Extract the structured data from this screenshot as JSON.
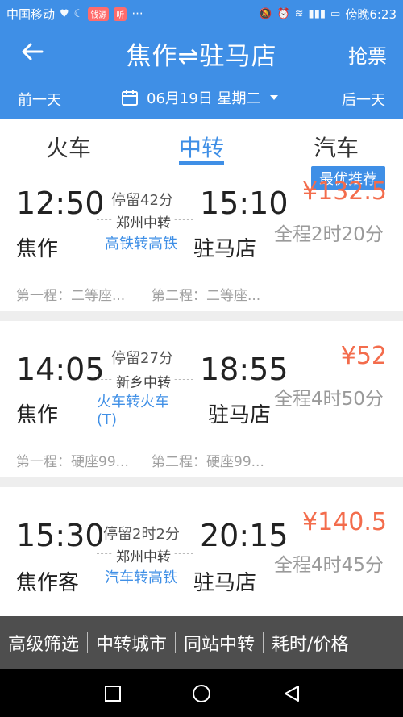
{
  "status_bar": {
    "carrier": "中国移动",
    "app_chip": "钱源",
    "app_icon": "听",
    "more": "···",
    "time": "傍晚6:23"
  },
  "header": {
    "title": "焦作⇌驻马店",
    "action": "抢票",
    "back_icon": "arrow-left-icon"
  },
  "date_bar": {
    "prev": "前一天",
    "date": "06月19日 星期二",
    "next": "后一天"
  },
  "tabs": [
    {
      "label": "火车"
    },
    {
      "label": "中转"
    },
    {
      "label": "汽车"
    }
  ],
  "cards": [
    {
      "badge": "最优推荐",
      "dep_time": "12:50",
      "arr_time": "15:10",
      "stop": "停留42分",
      "hub": "郑州中转",
      "type": "高铁转高铁",
      "dep_station": "焦作",
      "arr_station": "驻马店",
      "price": "¥132.5",
      "total": "全程2时20分",
      "seg1": "第一程：二等座...",
      "seg2": "第二程：二等座..."
    },
    {
      "badge": "",
      "dep_time": "14:05",
      "arr_time": "18:55",
      "stop": "停留27分",
      "hub": "新乡中转",
      "type": "火车转火车(T)",
      "dep_station": "焦作",
      "arr_station": "驻马店",
      "price": "¥52",
      "total": "全程4时50分",
      "seg1": "第一程：硬座99...",
      "seg2": "第二程：硬座99..."
    },
    {
      "badge": "",
      "dep_time": "15:30",
      "arr_time": "20:15",
      "stop": "停留2时2分",
      "hub": "郑州中转",
      "type": "汽车转高铁",
      "dep_station": "焦作客",
      "arr_station": "驻马店",
      "price": "¥140.5",
      "total": "全程4时45分",
      "seg1": "",
      "seg2": ""
    }
  ],
  "filter_bar": {
    "items": [
      "高级筛选",
      "中转城市",
      "同站中转",
      "耗时/价格"
    ]
  },
  "colors": {
    "primary": "#3f8fe6",
    "price": "#f36c4c",
    "filter_bg": "#4e4e4e"
  }
}
